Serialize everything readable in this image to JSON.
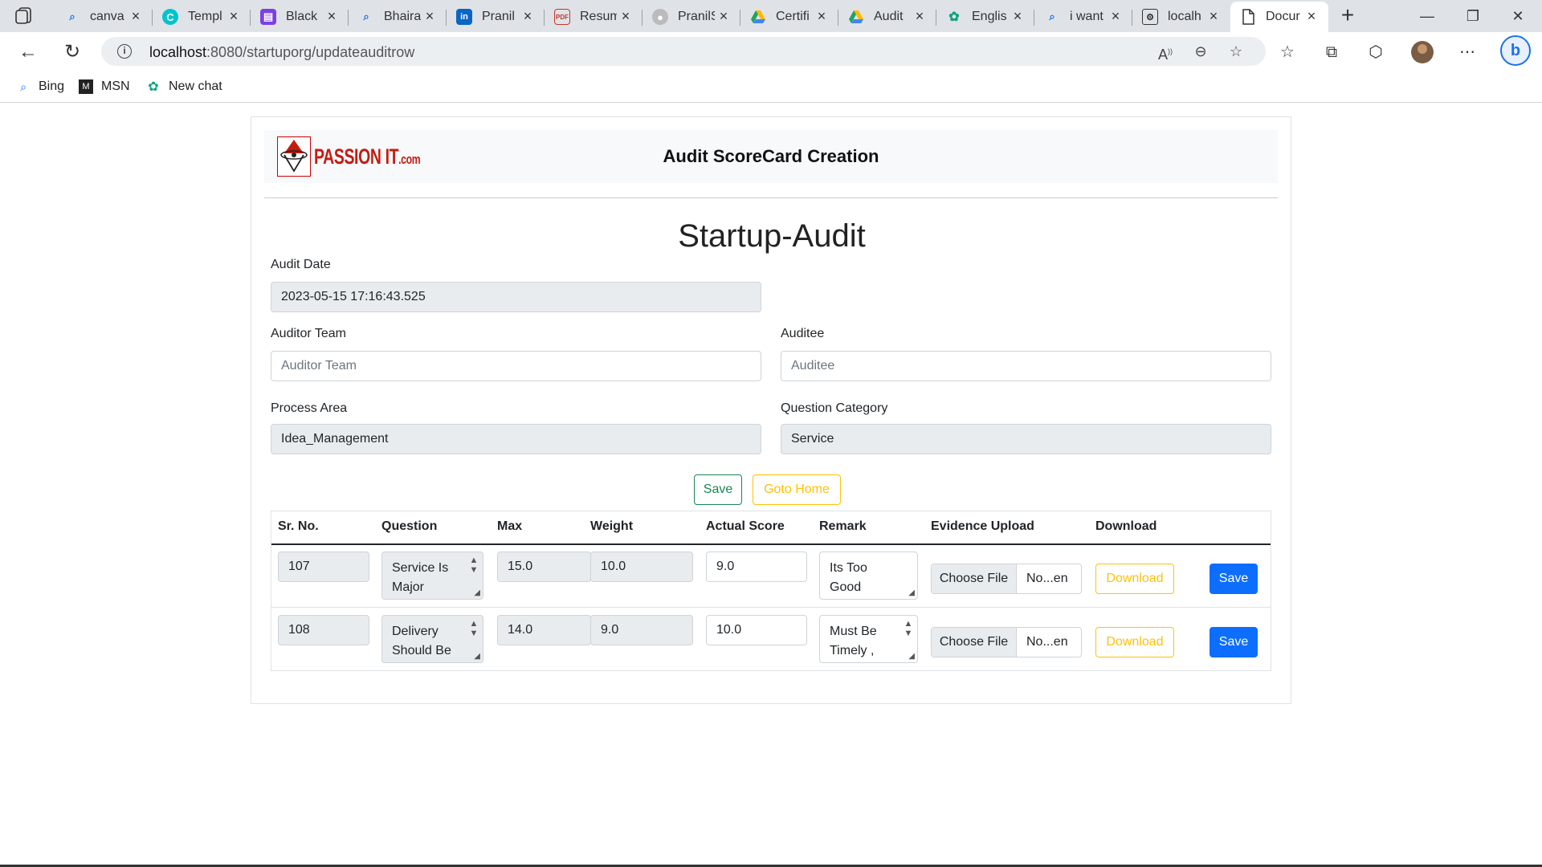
{
  "browser": {
    "tabs": [
      {
        "label": "canva",
        "icon": "search-icon",
        "icon_color": "#1a73e8"
      },
      {
        "label": "Templ",
        "icon": "canva-icon",
        "icon_color": "#00c4cc"
      },
      {
        "label": "Black",
        "icon": "purple-app-icon",
        "icon_color": "#7b3fe4"
      },
      {
        "label": "Bhaira",
        "icon": "search-icon",
        "icon_color": "#1a73e8"
      },
      {
        "label": "Pranil",
        "icon": "linkedin-icon",
        "icon_color": "#0a66c2"
      },
      {
        "label": "Resum",
        "icon": "pdf-icon",
        "icon_color": "#c0392b"
      },
      {
        "label": "PranilS",
        "icon": "github-icon",
        "icon_color": "#999999"
      },
      {
        "label": "Certifi",
        "icon": "google-drive-icon",
        "icon_color": "#1fa463"
      },
      {
        "label": "Audit",
        "icon": "google-drive-icon",
        "icon_color": "#1fa463"
      },
      {
        "label": "Englis",
        "icon": "chatgpt-icon",
        "icon_color": "#10a37f"
      },
      {
        "label": "i want",
        "icon": "search-icon",
        "icon_color": "#1a73e8"
      },
      {
        "label": "localh",
        "icon": "page-gear-icon",
        "icon_color": "#333333"
      },
      {
        "label": "Docur",
        "icon": "document-icon",
        "icon_color": "#333333"
      }
    ],
    "address": {
      "host": "localhost",
      "path": ":8080/startuporg/updateauditrow"
    },
    "favorites": [
      {
        "label": "Bing",
        "icon": "search-icon"
      },
      {
        "label": "MSN",
        "icon": "msn-icon"
      },
      {
        "label": "New chat",
        "icon": "chatgpt-icon"
      }
    ]
  },
  "header": {
    "logo_text": "PASSION IT",
    "logo_suffix": ".com",
    "title": "Audit ScoreCard Creation"
  },
  "form": {
    "title": "Startup-Audit",
    "audit_date": {
      "label": "Audit Date",
      "value": "2023-05-15 17:16:43.525"
    },
    "auditor_team": {
      "label": "Auditor Team",
      "placeholder": "Auditor Team"
    },
    "auditee": {
      "label": "Auditee",
      "placeholder": "Auditee"
    },
    "process_area": {
      "label": "Process Area",
      "value": "Idea_Management"
    },
    "question_category": {
      "label": "Question Category",
      "value": "Service"
    },
    "save_label": "Save",
    "home_label": "Goto Home"
  },
  "table": {
    "headers": [
      "Sr. No.",
      "Question",
      "Max",
      "Weight",
      "Actual Score",
      "Remark",
      "Evidence Upload",
      "Download"
    ],
    "rows": [
      {
        "sr": "107",
        "question": "Service Is Major",
        "max": "15.0",
        "weight": "10.0",
        "actual": "9.0",
        "remark": "Its Too Good",
        "choose": "Choose File",
        "file": "No...en",
        "download": "Download",
        "save": "Save"
      },
      {
        "sr": "108",
        "question": "Delivery Should Be",
        "max": "14.0",
        "weight": "9.0",
        "actual": "10.0",
        "remark": "Must Be Timely ,",
        "choose": "Choose File",
        "file": "No...en",
        "download": "Download",
        "save": "Save"
      }
    ]
  }
}
